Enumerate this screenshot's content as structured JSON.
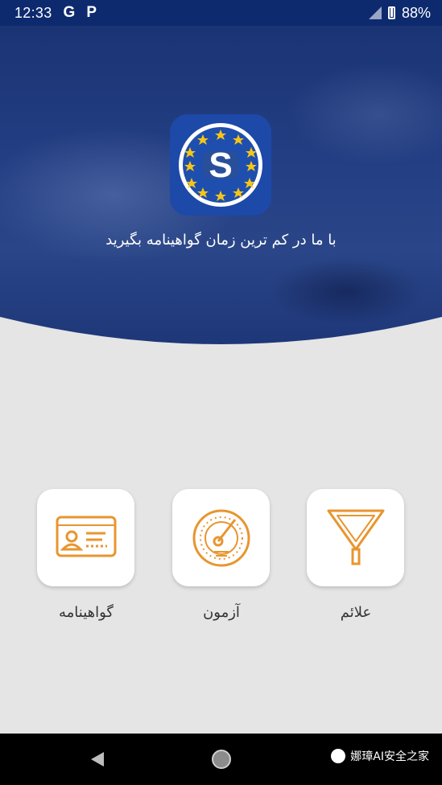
{
  "status_bar": {
    "time": "12:33",
    "icons": [
      "google-icon",
      "parking-icon",
      "signal-icon",
      "battery-icon"
    ],
    "g_glyph": "G",
    "p_glyph": "P",
    "battery": "88%"
  },
  "hero": {
    "tagline": "با ما در کم ترین زمان گواهینامه بگیرید",
    "logo_letter": "S"
  },
  "menu": {
    "items": [
      {
        "label": "گواهینامه",
        "icon": "id-card-icon"
      },
      {
        "label": "آزمون",
        "icon": "speedometer-icon"
      },
      {
        "label": "علائم",
        "icon": "yield-sign-icon"
      }
    ]
  },
  "nav_bar": {
    "watermark": "娜璋AI安全之家"
  },
  "colors": {
    "accent": "#e8952f",
    "hero_blue": "#1d3678",
    "status_bar": "#0d2a6e",
    "background": "#e5e5e5"
  }
}
